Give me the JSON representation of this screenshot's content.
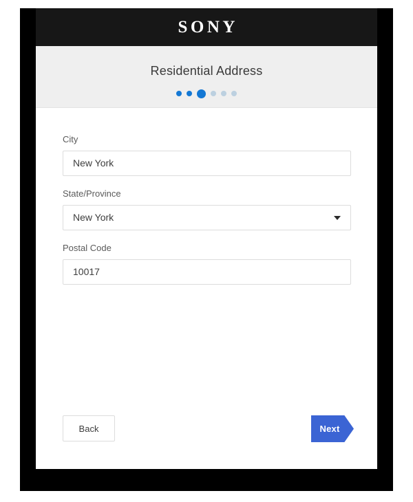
{
  "brand": {
    "logo_text": "SONY"
  },
  "step_header": {
    "title": "Residential Address",
    "progress": {
      "total_steps": 6,
      "current_step": 3,
      "dots": [
        {
          "state": "done"
        },
        {
          "state": "done"
        },
        {
          "state": "active"
        },
        {
          "state": "todo"
        },
        {
          "state": "todo"
        },
        {
          "state": "todo"
        }
      ],
      "active_color": "#1478d4",
      "inactive_color": "#bcd0e0"
    }
  },
  "form": {
    "fields": [
      {
        "name": "city",
        "label": "City",
        "value": "New York",
        "type": "text"
      },
      {
        "name": "state_province",
        "label": "State/Province",
        "value": "New York",
        "type": "select",
        "caret_icon": "chevron-down-icon"
      },
      {
        "name": "postal_code",
        "label": "Postal Code",
        "value": "10017",
        "type": "text"
      }
    ]
  },
  "footer": {
    "back_label": "Back",
    "next_label": "Next",
    "next_color": "#3b64d4"
  }
}
